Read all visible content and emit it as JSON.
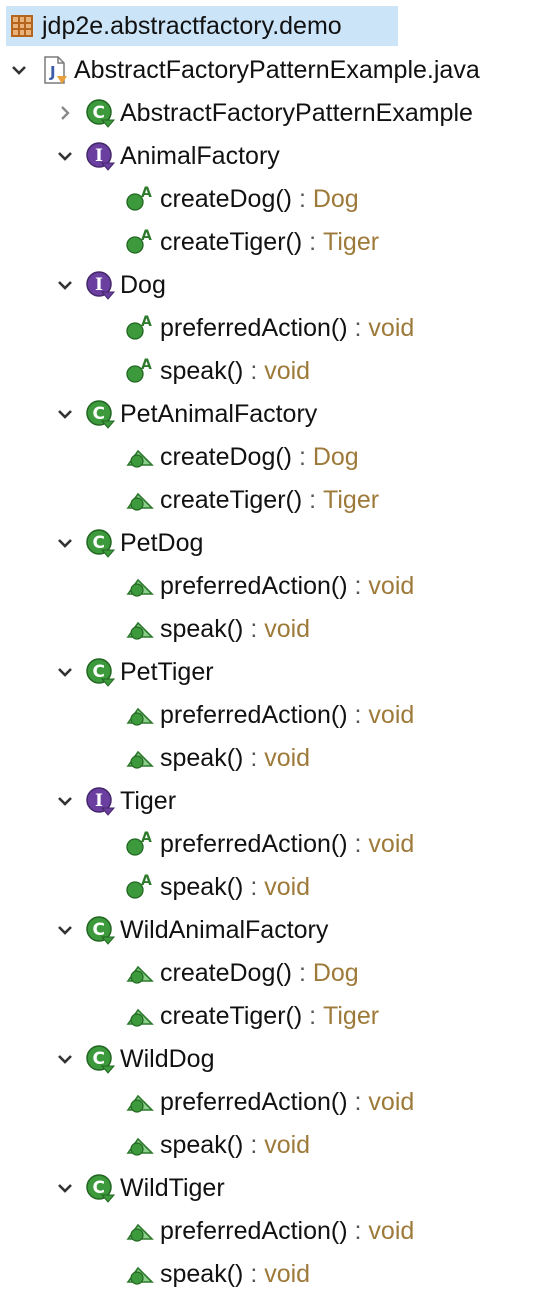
{
  "package": {
    "label": "jdp2e.abstractfactory.demo",
    "icon": "package-icon"
  },
  "file": {
    "label": "AbstractFactoryPatternExample.java",
    "icon": "java-file-icon"
  },
  "separator": " : ",
  "types": [
    {
      "name": "AbstractFactoryPatternExample",
      "kind": "class",
      "expanded": false,
      "members": []
    },
    {
      "name": "AnimalFactory",
      "kind": "interface",
      "expanded": true,
      "members": [
        {
          "name": "createDog()",
          "returns": "Dog",
          "visibility": "public-abstract"
        },
        {
          "name": "createTiger()",
          "returns": "Tiger",
          "visibility": "public-abstract"
        }
      ]
    },
    {
      "name": "Dog",
      "kind": "interface",
      "expanded": true,
      "members": [
        {
          "name": "preferredAction()",
          "returns": "void",
          "visibility": "public-abstract"
        },
        {
          "name": "speak()",
          "returns": "void",
          "visibility": "public-abstract"
        }
      ]
    },
    {
      "name": "PetAnimalFactory",
      "kind": "class",
      "expanded": true,
      "members": [
        {
          "name": "createDog()",
          "returns": "Dog",
          "visibility": "package"
        },
        {
          "name": "createTiger()",
          "returns": "Tiger",
          "visibility": "package"
        }
      ]
    },
    {
      "name": "PetDog",
      "kind": "class",
      "expanded": true,
      "members": [
        {
          "name": "preferredAction()",
          "returns": "void",
          "visibility": "package"
        },
        {
          "name": "speak()",
          "returns": "void",
          "visibility": "package"
        }
      ]
    },
    {
      "name": "PetTiger",
      "kind": "class",
      "expanded": true,
      "members": [
        {
          "name": "preferredAction()",
          "returns": "void",
          "visibility": "package"
        },
        {
          "name": "speak()",
          "returns": "void",
          "visibility": "package"
        }
      ]
    },
    {
      "name": "Tiger",
      "kind": "interface",
      "expanded": true,
      "members": [
        {
          "name": "preferredAction()",
          "returns": "void",
          "visibility": "public-abstract"
        },
        {
          "name": "speak()",
          "returns": "void",
          "visibility": "public-abstract"
        }
      ]
    },
    {
      "name": "WildAnimalFactory",
      "kind": "class",
      "expanded": true,
      "members": [
        {
          "name": "createDog()",
          "returns": "Dog",
          "visibility": "package"
        },
        {
          "name": "createTiger()",
          "returns": "Tiger",
          "visibility": "package"
        }
      ]
    },
    {
      "name": "WildDog",
      "kind": "class",
      "expanded": true,
      "members": [
        {
          "name": "preferredAction()",
          "returns": "void",
          "visibility": "package"
        },
        {
          "name": "speak()",
          "returns": "void",
          "visibility": "package"
        }
      ]
    },
    {
      "name": "WildTiger",
      "kind": "class",
      "expanded": true,
      "members": [
        {
          "name": "preferredAction()",
          "returns": "void",
          "visibility": "package"
        },
        {
          "name": "speak()",
          "returns": "void",
          "visibility": "package"
        }
      ]
    }
  ],
  "colors": {
    "selection": "#cce4f7",
    "return_type": "#9e7a3a",
    "class_green": "#3c9a3c",
    "interface_purple": "#6a3fa0",
    "package_brown": "#b5651d"
  }
}
